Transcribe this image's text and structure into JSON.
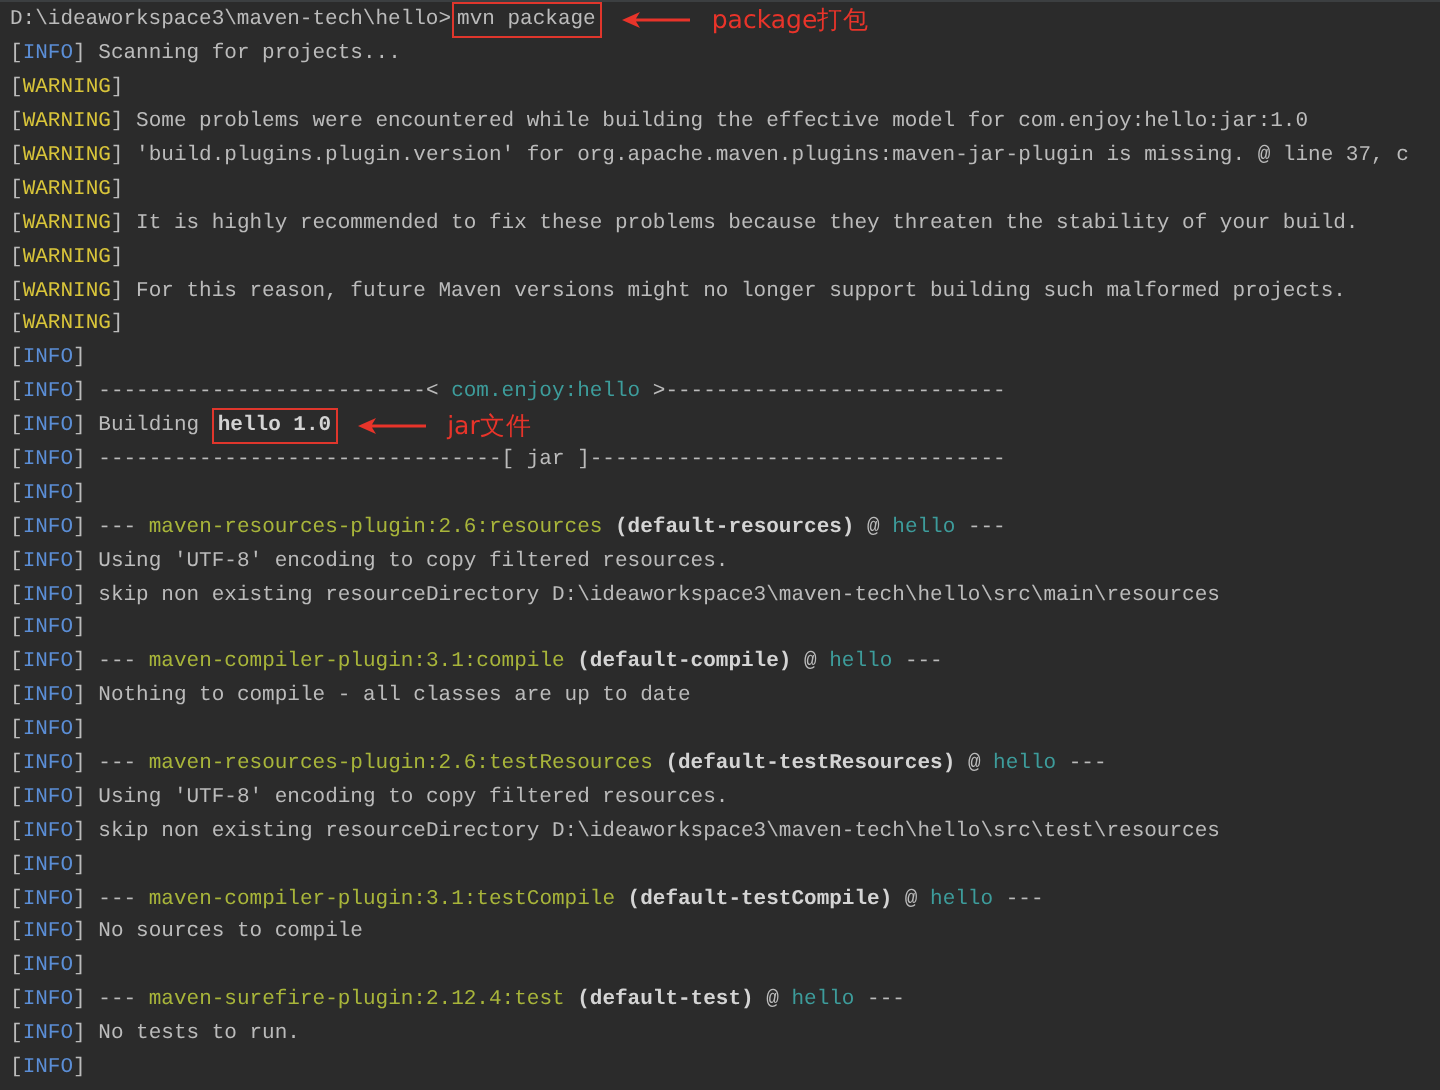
{
  "terminal": {
    "lines": [
      {
        "segments": [
          {
            "kind": "text",
            "text": "D:\\ideaworkspace3\\maven-tech\\hello>"
          },
          {
            "kind": "text",
            "text": "mvn package",
            "boxed": true
          }
        ],
        "note": "package打包"
      },
      {
        "segments": [
          {
            "kind": "info",
            "text": "[INFO]"
          },
          {
            "kind": "text",
            "text": " Scanning for projects..."
          }
        ]
      },
      {
        "segments": [
          {
            "kind": "warning",
            "text": "[WARNING]"
          }
        ]
      },
      {
        "segments": [
          {
            "kind": "warning",
            "text": "[WARNING]"
          },
          {
            "kind": "text",
            "text": " Some problems were encountered while building the effective model for com.enjoy:hello:jar:1.0"
          }
        ]
      },
      {
        "segments": [
          {
            "kind": "warning",
            "text": "[WARNING]"
          },
          {
            "kind": "text",
            "text": " 'build.plugins.plugin.version' for org.apache.maven.plugins:maven-jar-plugin is missing. @ line 37, c"
          }
        ]
      },
      {
        "segments": [
          {
            "kind": "warning",
            "text": "[WARNING]"
          }
        ]
      },
      {
        "segments": [
          {
            "kind": "warning",
            "text": "[WARNING]"
          },
          {
            "kind": "text",
            "text": " It is highly recommended to fix these problems because they threaten the stability of your build."
          }
        ]
      },
      {
        "segments": [
          {
            "kind": "warning",
            "text": "[WARNING]"
          }
        ]
      },
      {
        "segments": [
          {
            "kind": "warning",
            "text": "[WARNING]"
          },
          {
            "kind": "text",
            "text": " For this reason, future Maven versions might no longer support building such malformed projects."
          }
        ]
      },
      {
        "segments": [
          {
            "kind": "warning",
            "text": "[WARNING]"
          }
        ]
      },
      {
        "segments": [
          {
            "kind": "info",
            "text": "[INFO]"
          }
        ]
      },
      {
        "segments": [
          {
            "kind": "info",
            "text": "[INFO]"
          },
          {
            "kind": "text",
            "text": " --------------------------< "
          },
          {
            "kind": "project",
            "text": "com.enjoy:hello"
          },
          {
            "kind": "text",
            "text": " >---------------------------"
          }
        ]
      },
      {
        "segments": [
          {
            "kind": "info",
            "text": "[INFO]"
          },
          {
            "kind": "text",
            "text": " Building "
          },
          {
            "kind": "bold",
            "text": "hello 1.0",
            "boxed": true
          }
        ],
        "note": "jar文件"
      },
      {
        "segments": [
          {
            "kind": "info",
            "text": "[INFO]"
          },
          {
            "kind": "text",
            "text": " --------------------------------[ jar ]---------------------------------"
          }
        ]
      },
      {
        "segments": [
          {
            "kind": "info",
            "text": "[INFO]"
          }
        ]
      },
      {
        "segments": [
          {
            "kind": "info",
            "text": "[INFO]"
          },
          {
            "kind": "text",
            "text": " --- "
          },
          {
            "kind": "plugin",
            "text": "maven-resources-plugin:2.6:resources"
          },
          {
            "kind": "bold",
            "text": " (default-resources)"
          },
          {
            "kind": "text",
            "text": " @ "
          },
          {
            "kind": "project",
            "text": "hello"
          },
          {
            "kind": "text",
            "text": " ---"
          }
        ]
      },
      {
        "segments": [
          {
            "kind": "info",
            "text": "[INFO]"
          },
          {
            "kind": "text",
            "text": " Using 'UTF-8' encoding to copy filtered resources."
          }
        ]
      },
      {
        "segments": [
          {
            "kind": "info",
            "text": "[INFO]"
          },
          {
            "kind": "text",
            "text": " skip non existing resourceDirectory D:\\ideaworkspace3\\maven-tech\\hello\\src\\main\\resources"
          }
        ]
      },
      {
        "segments": [
          {
            "kind": "info",
            "text": "[INFO]"
          }
        ]
      },
      {
        "segments": [
          {
            "kind": "info",
            "text": "[INFO]"
          },
          {
            "kind": "text",
            "text": " --- "
          },
          {
            "kind": "plugin",
            "text": "maven-compiler-plugin:3.1:compile"
          },
          {
            "kind": "bold",
            "text": " (default-compile)"
          },
          {
            "kind": "text",
            "text": " @ "
          },
          {
            "kind": "project",
            "text": "hello"
          },
          {
            "kind": "text",
            "text": " ---"
          }
        ]
      },
      {
        "segments": [
          {
            "kind": "info",
            "text": "[INFO]"
          },
          {
            "kind": "text",
            "text": " Nothing to compile - all classes are up to date"
          }
        ]
      },
      {
        "segments": [
          {
            "kind": "info",
            "text": "[INFO]"
          }
        ]
      },
      {
        "segments": [
          {
            "kind": "info",
            "text": "[INFO]"
          },
          {
            "kind": "text",
            "text": " --- "
          },
          {
            "kind": "plugin",
            "text": "maven-resources-plugin:2.6:testResources"
          },
          {
            "kind": "bold",
            "text": " (default-testResources)"
          },
          {
            "kind": "text",
            "text": " @ "
          },
          {
            "kind": "project",
            "text": "hello"
          },
          {
            "kind": "text",
            "text": " ---"
          }
        ]
      },
      {
        "segments": [
          {
            "kind": "info",
            "text": "[INFO]"
          },
          {
            "kind": "text",
            "text": " Using 'UTF-8' encoding to copy filtered resources."
          }
        ]
      },
      {
        "segments": [
          {
            "kind": "info",
            "text": "[INFO]"
          },
          {
            "kind": "text",
            "text": " skip non existing resourceDirectory D:\\ideaworkspace3\\maven-tech\\hello\\src\\test\\resources"
          }
        ]
      },
      {
        "segments": [
          {
            "kind": "info",
            "text": "[INFO]"
          }
        ]
      },
      {
        "segments": [
          {
            "kind": "info",
            "text": "[INFO]"
          },
          {
            "kind": "text",
            "text": " --- "
          },
          {
            "kind": "plugin",
            "text": "maven-compiler-plugin:3.1:testCompile"
          },
          {
            "kind": "bold",
            "text": " (default-testCompile)"
          },
          {
            "kind": "text",
            "text": " @ "
          },
          {
            "kind": "project",
            "text": "hello"
          },
          {
            "kind": "text",
            "text": " ---"
          }
        ]
      },
      {
        "segments": [
          {
            "kind": "info",
            "text": "[INFO]"
          },
          {
            "kind": "text",
            "text": " No sources to compile"
          }
        ]
      },
      {
        "segments": [
          {
            "kind": "info",
            "text": "[INFO]"
          }
        ]
      },
      {
        "segments": [
          {
            "kind": "info",
            "text": "[INFO]"
          },
          {
            "kind": "text",
            "text": " --- "
          },
          {
            "kind": "plugin",
            "text": "maven-surefire-plugin:2.12.4:test"
          },
          {
            "kind": "bold",
            "text": " (default-test)"
          },
          {
            "kind": "text",
            "text": " @ "
          },
          {
            "kind": "project",
            "text": "hello"
          },
          {
            "kind": "text",
            "text": " ---"
          }
        ]
      },
      {
        "segments": [
          {
            "kind": "info",
            "text": "[INFO]"
          },
          {
            "kind": "text",
            "text": " No tests to run."
          }
        ]
      },
      {
        "segments": [
          {
            "kind": "info",
            "text": "[INFO]"
          }
        ]
      }
    ]
  }
}
